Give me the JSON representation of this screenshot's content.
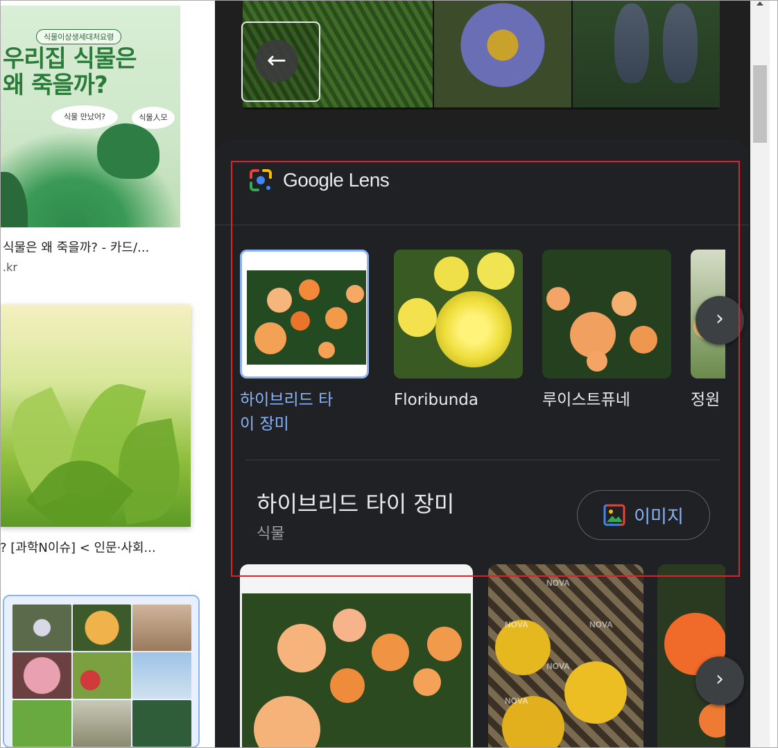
{
  "left": {
    "card1": {
      "tag": "식물이상생세대처요령",
      "title_line1": "우리집 식물은",
      "title_line2": "왜 죽을까?",
      "bubble1": "식물 만났어?",
      "bubble2": "식물人모",
      "caption": "식물은 왜 죽을까? - 카드/...",
      "domain": ".kr"
    },
    "card2": {
      "caption": "? [과학N이슈] < 인문·사회..."
    }
  },
  "lens": {
    "title_google": "Google",
    "title_lens": " Lens",
    "carousel": [
      {
        "label": "하이브리드 타\n이 장미",
        "selected": true
      },
      {
        "label": "Floribunda",
        "selected": false
      },
      {
        "label": "루이스트퓨네",
        "selected": false
      },
      {
        "label": "정원",
        "selected": false
      }
    ],
    "entity": {
      "name": "하이브리드 타이 장미",
      "type": "식물",
      "images_button": "이미지"
    },
    "watermark": "NOVA"
  },
  "colors": {
    "accent": "#8ab4f8",
    "panel": "#202124",
    "highlight_box": "#e0202a"
  },
  "icons": {
    "back": "arrow-left-icon",
    "next": "chevron-right-icon",
    "lens": "google-lens-icon",
    "images": "image-icon"
  }
}
